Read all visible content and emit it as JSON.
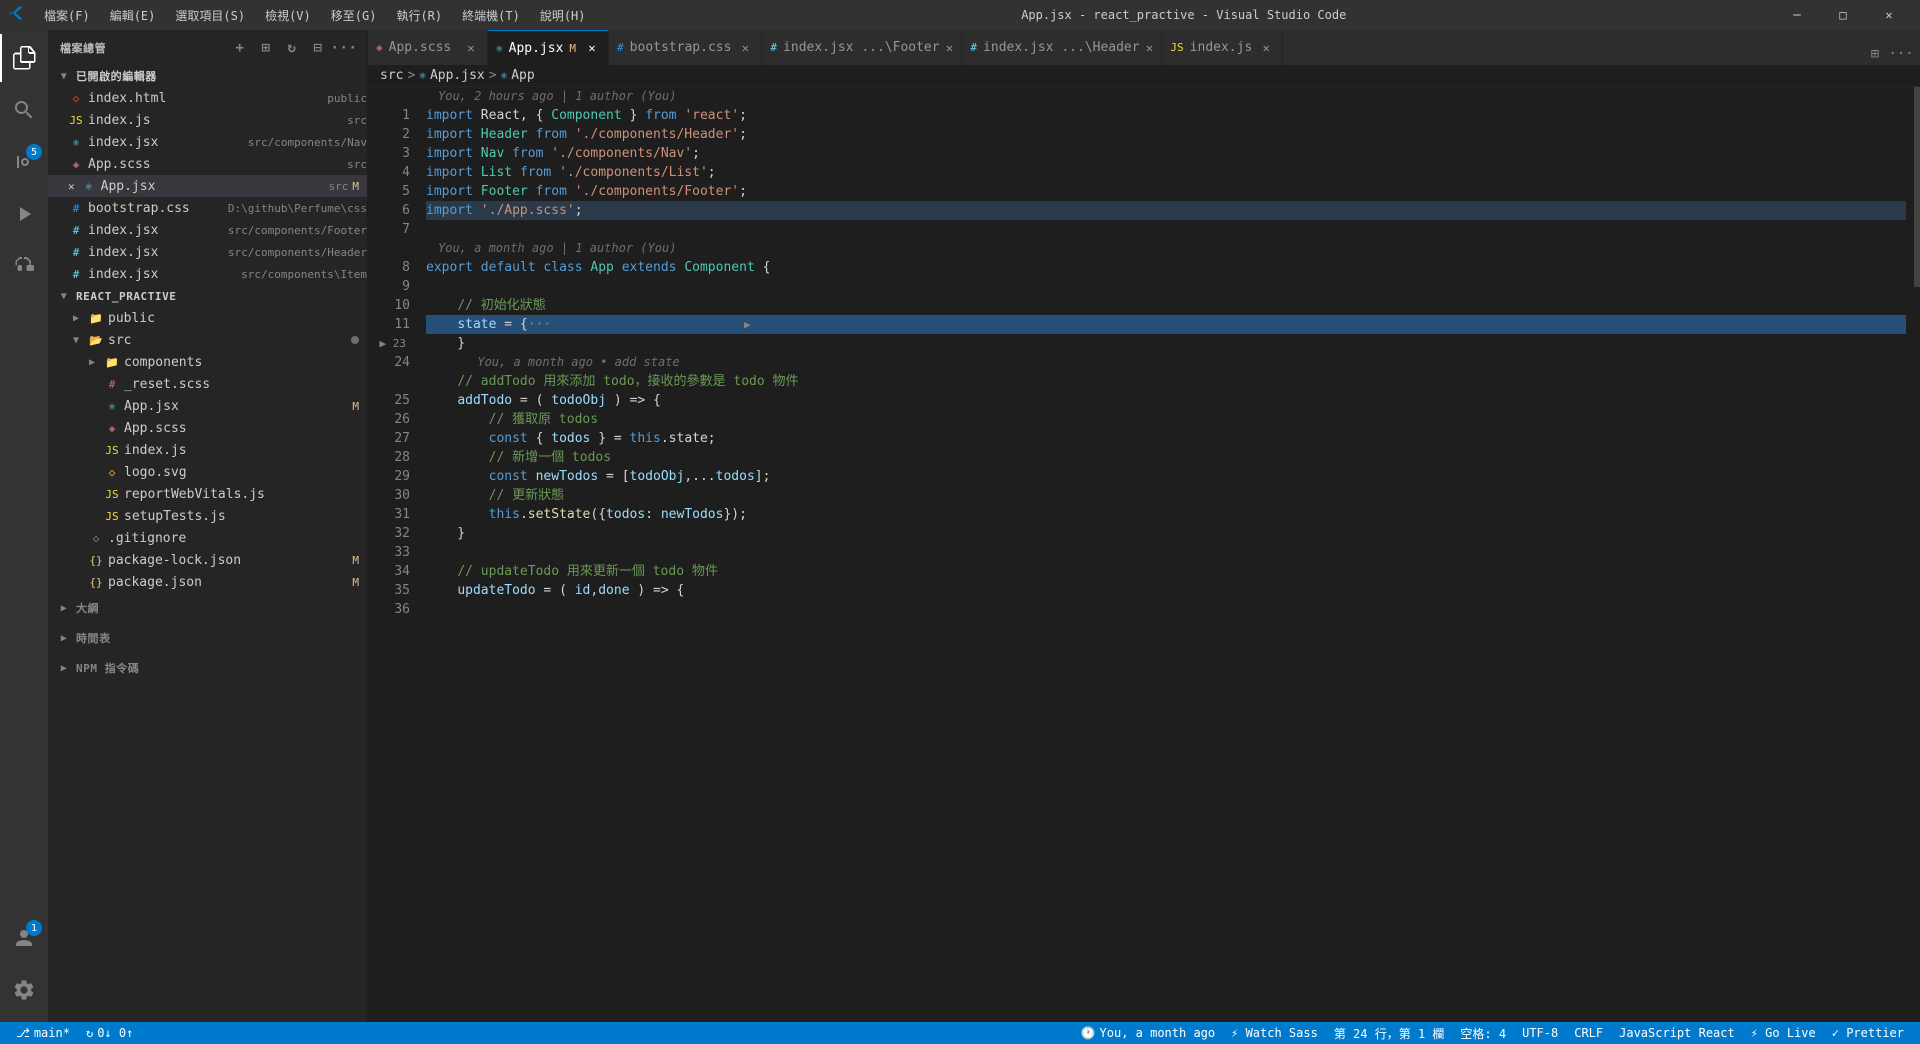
{
  "titleBar": {
    "logo": "VS",
    "menus": [
      "檔案(F)",
      "編輯(E)",
      "選取項目(S)",
      "檢視(V)",
      "移至(G)",
      "執行(R)",
      "終端機(T)",
      "說明(H)"
    ],
    "title": "App.jsx - react_practive - Visual Studio Code",
    "controls": [
      "─",
      "□",
      "✕"
    ]
  },
  "tabs": [
    {
      "icon": "scss",
      "label": "App.scss",
      "active": false,
      "modified": false
    },
    {
      "icon": "jsx",
      "label": "App.jsx",
      "active": true,
      "modified": true
    },
    {
      "icon": "css",
      "label": "bootstrap.css",
      "active": false,
      "modified": false
    },
    {
      "icon": "jsx",
      "label": "index.jsx",
      "path": "...\\Header",
      "active": false,
      "modified": false
    },
    {
      "icon": "jsx",
      "label": "index.jsx",
      "path": "...\\Footer",
      "active": false,
      "modified": false
    },
    {
      "icon": "jsx",
      "label": "index.js",
      "path": "",
      "active": false,
      "modified": false
    }
  ],
  "breadcrumb": {
    "parts": [
      "src",
      "App.jsx",
      "App"
    ]
  },
  "sidebar": {
    "title": "檔案總管",
    "openEditors": {
      "label": "已開啟的編輯器",
      "files": [
        {
          "icon": "html",
          "name": "index.html",
          "path": "public",
          "modified": false
        },
        {
          "icon": "js",
          "name": "index.js",
          "path": "src",
          "modified": false
        },
        {
          "icon": "jsx",
          "name": "index.jsx",
          "path": "src/components/Nav",
          "modified": false
        },
        {
          "icon": "scss",
          "name": "App.scss",
          "path": "src",
          "modified": false
        },
        {
          "icon": "jsx",
          "name": "App.jsx",
          "path": "src",
          "modified": true,
          "active": true
        },
        {
          "icon": "css",
          "name": "bootstrap.css",
          "path": "D:\\github\\Perfume\\css",
          "modified": false
        },
        {
          "icon": "jsx",
          "name": "index.jsx",
          "path": "src/components/Footer",
          "modified": false
        },
        {
          "icon": "jsx",
          "name": "index.jsx",
          "path": "src/components/Header",
          "modified": false
        },
        {
          "icon": "jsx",
          "name": "index.jsx",
          "path": "src/components\\Item",
          "modified": false
        }
      ]
    },
    "project": {
      "label": "REACT_PRACTIVE",
      "items": [
        {
          "indent": 1,
          "type": "folder",
          "name": "public",
          "open": false
        },
        {
          "indent": 1,
          "type": "folder",
          "name": "src",
          "open": true
        },
        {
          "indent": 2,
          "type": "folder",
          "name": "components",
          "open": false
        },
        {
          "indent": 2,
          "type": "file",
          "name": "_reset.scss",
          "icon": "scss"
        },
        {
          "indent": 2,
          "type": "file",
          "name": "App.jsx",
          "icon": "jsx",
          "modified": true
        },
        {
          "indent": 2,
          "type": "file",
          "name": "App.scss",
          "icon": "scss"
        },
        {
          "indent": 2,
          "type": "file",
          "name": "index.js",
          "icon": "js"
        },
        {
          "indent": 2,
          "type": "file",
          "name": "logo.svg",
          "icon": "svg"
        },
        {
          "indent": 2,
          "type": "file",
          "name": "reportWebVitals.js",
          "icon": "js"
        },
        {
          "indent": 2,
          "type": "file",
          "name": "setupTests.js",
          "icon": "js"
        },
        {
          "indent": 1,
          "type": "file",
          "name": ".gitignore",
          "icon": "git"
        },
        {
          "indent": 1,
          "type": "file",
          "name": "package-lock.json",
          "icon": "json",
          "modified": true
        },
        {
          "indent": 1,
          "type": "file",
          "name": "package.json",
          "icon": "json",
          "modified": true
        }
      ]
    },
    "outline": {
      "label": "大綱"
    },
    "timeline": {
      "label": "時間表"
    },
    "npm": {
      "label": "NPM 指令碼"
    }
  },
  "code": {
    "blameTop": "You, 2 hours ago | 1 author (You)",
    "blameMiddle": "You, a month ago | 1 author (You)",
    "blameAddState": "You, a month ago • add state",
    "lines": [
      {
        "num": 1,
        "tokens": [
          {
            "t": "kw",
            "v": "import"
          },
          {
            "t": "plain",
            "v": " React, { "
          },
          {
            "t": "cls",
            "v": "Component"
          },
          {
            "t": "plain",
            "v": " } "
          },
          {
            "t": "kw",
            "v": "from"
          },
          {
            "t": "plain",
            "v": " "
          },
          {
            "t": "str",
            "v": "'react'"
          },
          {
            "t": "plain",
            "v": ";"
          }
        ]
      },
      {
        "num": 2,
        "tokens": [
          {
            "t": "kw",
            "v": "import"
          },
          {
            "t": "plain",
            "v": " "
          },
          {
            "t": "cls",
            "v": "Header"
          },
          {
            "t": "plain",
            "v": " "
          },
          {
            "t": "kw",
            "v": "from"
          },
          {
            "t": "plain",
            "v": " "
          },
          {
            "t": "str",
            "v": "'./components/Header'"
          },
          {
            "t": "plain",
            "v": ";"
          }
        ]
      },
      {
        "num": 3,
        "tokens": [
          {
            "t": "kw",
            "v": "import"
          },
          {
            "t": "plain",
            "v": " "
          },
          {
            "t": "cls",
            "v": "Nav"
          },
          {
            "t": "plain",
            "v": " "
          },
          {
            "t": "kw",
            "v": "from"
          },
          {
            "t": "plain",
            "v": " "
          },
          {
            "t": "str",
            "v": "'./components/Nav'"
          },
          {
            "t": "plain",
            "v": ";"
          }
        ]
      },
      {
        "num": 4,
        "tokens": [
          {
            "t": "kw",
            "v": "import"
          },
          {
            "t": "plain",
            "v": " "
          },
          {
            "t": "cls",
            "v": "List"
          },
          {
            "t": "plain",
            "v": " "
          },
          {
            "t": "kw",
            "v": "from"
          },
          {
            "t": "plain",
            "v": " "
          },
          {
            "t": "str",
            "v": "'./components/List'"
          },
          {
            "t": "plain",
            "v": ";"
          }
        ]
      },
      {
        "num": 5,
        "tokens": [
          {
            "t": "kw",
            "v": "import"
          },
          {
            "t": "plain",
            "v": " "
          },
          {
            "t": "cls",
            "v": "Footer"
          },
          {
            "t": "plain",
            "v": " "
          },
          {
            "t": "kw",
            "v": "from"
          },
          {
            "t": "plain",
            "v": " "
          },
          {
            "t": "str",
            "v": "'./components/Footer'"
          },
          {
            "t": "plain",
            "v": ";"
          }
        ]
      },
      {
        "num": 6,
        "tokens": [
          {
            "t": "kw",
            "v": "import"
          },
          {
            "t": "plain",
            "v": " "
          },
          {
            "t": "str",
            "v": "'./App.scss'"
          },
          {
            "t": "plain",
            "v": ";"
          }
        ],
        "highlighted": true
      },
      {
        "num": 7,
        "tokens": [
          {
            "t": "plain",
            "v": ""
          }
        ]
      },
      {
        "num": 8,
        "tokens": [
          {
            "t": "kw",
            "v": "export"
          },
          {
            "t": "plain",
            "v": " "
          },
          {
            "t": "kw",
            "v": "default"
          },
          {
            "t": "plain",
            "v": " "
          },
          {
            "t": "kw",
            "v": "class"
          },
          {
            "t": "plain",
            "v": " "
          },
          {
            "t": "cls",
            "v": "App"
          },
          {
            "t": "plain",
            "v": " "
          },
          {
            "t": "kw",
            "v": "extends"
          },
          {
            "t": "plain",
            "v": " "
          },
          {
            "t": "cls",
            "v": "Component"
          },
          {
            "t": "plain",
            "v": " {"
          }
        ]
      },
      {
        "num": 9,
        "tokens": [
          {
            "t": "plain",
            "v": ""
          }
        ]
      },
      {
        "num": 10,
        "tokens": [
          {
            "t": "plain",
            "v": "    "
          },
          {
            "t": "cmt",
            "v": "// 初始化狀態"
          }
        ]
      },
      {
        "num": 11,
        "tokens": [
          {
            "t": "plain",
            "v": "    "
          },
          {
            "t": "var",
            "v": "state"
          },
          {
            "t": "plain",
            "v": " = {···"
          }
        ],
        "selected": true
      },
      {
        "num": 23,
        "tokens": [
          {
            "t": "plain",
            "v": "    }"
          }
        ]
      },
      {
        "num": 24,
        "tokens": [
          {
            "t": "plain",
            "v": ""
          }
        ],
        "blame": "You, a month ago • add state"
      },
      {
        "num": 25,
        "tokens": [
          {
            "t": "plain",
            "v": "    "
          },
          {
            "t": "cmt",
            "v": "// addTodo 用來添加 todo，接收的參數是 todo 物件"
          }
        ]
      },
      {
        "num": 26,
        "tokens": [
          {
            "t": "plain",
            "v": "    "
          },
          {
            "t": "var",
            "v": "addTodo"
          },
          {
            "t": "plain",
            "v": " = ( "
          },
          {
            "t": "var",
            "v": "todoObj"
          },
          {
            "t": "plain",
            "v": " ) => {"
          }
        ]
      },
      {
        "num": 27,
        "tokens": [
          {
            "t": "plain",
            "v": "        "
          },
          {
            "t": "cmt",
            "v": "// 獲取原 todos"
          }
        ]
      },
      {
        "num": 28,
        "tokens": [
          {
            "t": "plain",
            "v": "        "
          },
          {
            "t": "kw",
            "v": "const"
          },
          {
            "t": "plain",
            "v": " { "
          },
          {
            "t": "var",
            "v": "todos"
          },
          {
            "t": "plain",
            "v": " } = "
          },
          {
            "t": "kw",
            "v": "this"
          },
          {
            "t": "plain",
            "v": ".state;"
          }
        ]
      },
      {
        "num": 29,
        "tokens": [
          {
            "t": "plain",
            "v": "        "
          },
          {
            "t": "cmt",
            "v": "// 新增一個 todos"
          }
        ]
      },
      {
        "num": 30,
        "tokens": [
          {
            "t": "plain",
            "v": "        "
          },
          {
            "t": "kw",
            "v": "const"
          },
          {
            "t": "plain",
            "v": " "
          },
          {
            "t": "var",
            "v": "newTodos"
          },
          {
            "t": "plain",
            "v": " = ["
          },
          {
            "t": "var",
            "v": "todoObj"
          },
          {
            "t": "plain",
            "v": ",..."
          },
          {
            "t": "var",
            "v": "todos"
          },
          {
            "t": "plain",
            "v": "];"
          }
        ]
      },
      {
        "num": 31,
        "tokens": [
          {
            "t": "plain",
            "v": "        "
          },
          {
            "t": "cmt",
            "v": "// 更新狀態"
          }
        ]
      },
      {
        "num": 32,
        "tokens": [
          {
            "t": "plain",
            "v": "        "
          },
          {
            "t": "kw",
            "v": "this"
          },
          {
            "t": "plain",
            "v": "."
          },
          {
            "t": "fn",
            "v": "setState"
          },
          {
            "t": "plain",
            "v": "({"
          },
          {
            "t": "var",
            "v": "todos"
          },
          {
            "t": "plain",
            "v": ": "
          },
          {
            "t": "var",
            "v": "newTodos"
          },
          {
            "t": "plain",
            "v": "});"
          }
        ]
      },
      {
        "num": 33,
        "tokens": [
          {
            "t": "plain",
            "v": "    }"
          }
        ]
      },
      {
        "num": 34,
        "tokens": [
          {
            "t": "plain",
            "v": ""
          }
        ]
      },
      {
        "num": 35,
        "tokens": [
          {
            "t": "plain",
            "v": "    "
          },
          {
            "t": "cmt",
            "v": "// updateTodo 用來更新一個 todo 物件"
          }
        ]
      },
      {
        "num": 36,
        "tokens": [
          {
            "t": "plain",
            "v": "    "
          },
          {
            "t": "var",
            "v": "updateTodo"
          },
          {
            "t": "plain",
            "v": " = ( "
          },
          {
            "t": "var",
            "v": "id"
          },
          {
            "t": "plain",
            "v": ","
          },
          {
            "t": "var",
            "v": "done"
          },
          {
            "t": "plain",
            "v": " ) => {"
          }
        ]
      }
    ]
  },
  "statusBar": {
    "branch": "main*",
    "sync": "0↓ 0↑",
    "blame": "You, a month ago",
    "watchSass": "⚡ Watch Sass",
    "cursor": "第 24 行，第 1 欄",
    "spaces": "空格: 4",
    "encoding": "UTF-8",
    "lineEnding": "CRLF",
    "language": "JavaScript React",
    "goLive": "⚡ Go Live",
    "prettier": "✓ Prettier"
  }
}
